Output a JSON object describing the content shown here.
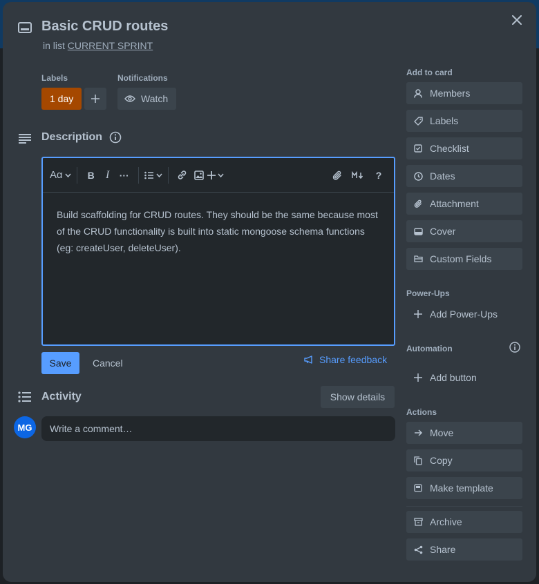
{
  "card": {
    "title": "Basic CRUD routes",
    "in_list_prefix": "in list",
    "list_name": "CURRENT SPRINT"
  },
  "labels": {
    "heading": "Labels",
    "chip": "1 day",
    "chip_color": "#a54800"
  },
  "notifications": {
    "heading": "Notifications",
    "watch_label": "Watch"
  },
  "description": {
    "heading": "Description",
    "body": "Build scaffolding for CRUD routes. They should be the same because most of the CRUD functionality is built into static mongoose schema functions (eg: createUser, deleteUser).",
    "toolbar": {
      "text_style": "Aα",
      "bold": "B",
      "italic": "I",
      "more": "···",
      "help": "?"
    },
    "save_label": "Save",
    "cancel_label": "Cancel",
    "feedback_label": "Share feedback"
  },
  "activity": {
    "heading": "Activity",
    "show_details": "Show details",
    "avatar_initials": "MG",
    "comment_placeholder": "Write a comment…"
  },
  "sidebar": {
    "add_to_card": {
      "heading": "Add to card",
      "items": [
        {
          "label": "Members",
          "icon": "person-icon"
        },
        {
          "label": "Labels",
          "icon": "tag-icon"
        },
        {
          "label": "Checklist",
          "icon": "checklist-icon"
        },
        {
          "label": "Dates",
          "icon": "clock-icon"
        },
        {
          "label": "Attachment",
          "icon": "paperclip-icon"
        },
        {
          "label": "Cover",
          "icon": "cover-icon"
        },
        {
          "label": "Custom Fields",
          "icon": "custom-fields-icon"
        }
      ]
    },
    "power_ups": {
      "heading": "Power-Ups",
      "add_label": "Add Power-Ups"
    },
    "automation": {
      "heading": "Automation",
      "add_label": "Add button"
    },
    "actions": {
      "heading": "Actions",
      "items": [
        {
          "label": "Move",
          "icon": "arrow-right-icon"
        },
        {
          "label": "Copy",
          "icon": "copy-icon"
        },
        {
          "label": "Make template",
          "icon": "template-icon"
        },
        {
          "label": "Archive",
          "icon": "archive-icon"
        },
        {
          "label": "Share",
          "icon": "share-icon"
        }
      ]
    }
  },
  "colors": {
    "modal_bg": "#323940",
    "button_bg": "#3b444c",
    "accent": "#579dff",
    "avatar": "#0c66e4"
  }
}
